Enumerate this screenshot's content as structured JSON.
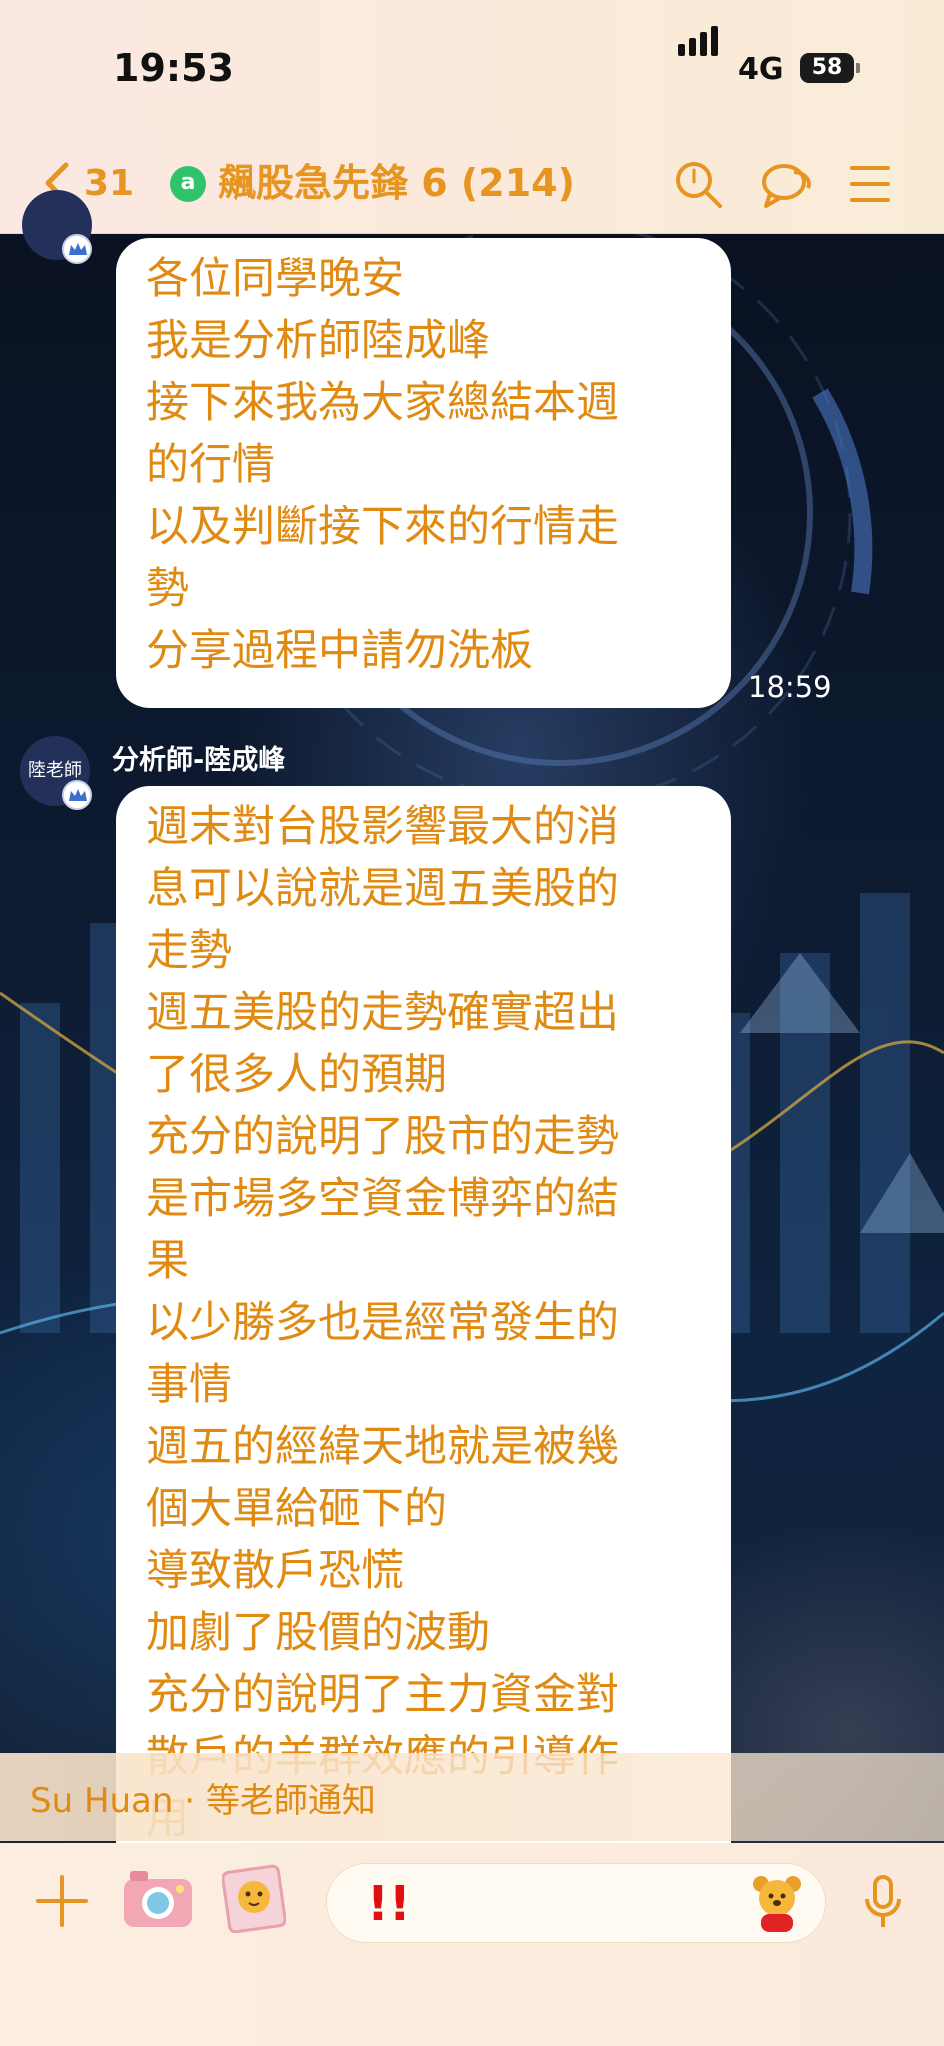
{
  "status_bar": {
    "time": "19:53",
    "network": "4G",
    "battery": "58"
  },
  "header": {
    "back_count": "31",
    "title": "飆股急先鋒 6 (214)",
    "icons": [
      "back-chevron-icon",
      "search-icon",
      "chat-bubbles-icon",
      "menu-icon"
    ],
    "accent_color": "#e59520"
  },
  "messages": [
    {
      "lines": [
        "各位同學晚安",
        "我是分析師陸成峰",
        "接下來我為大家總結本週",
        "的行情",
        "以及判斷接下來的行情走",
        "勢",
        "分享過程中請勿洗板"
      ],
      "time": "18:59"
    },
    {
      "sender": "分析師-陸成峰",
      "avatar_text": "陸老師",
      "lines": [
        "週末對台股影響最大的消",
        "息可以說就是週五美股的",
        "走勢",
        "週五美股的走勢確實超出",
        "了很多人的預期",
        "充分的說明了股市的走勢",
        "是市場多空資金博弈的結",
        "果",
        "以少勝多也是經常發生的",
        "事情",
        "週五的經緯天地就是被幾",
        "個大單給砸下的",
        "導致散戶恐慌",
        "加劇了股價的波動",
        "充分的說明了主力資金對",
        "散戶的羊群效應的引導作",
        "用"
      ]
    }
  ],
  "notice": "Su Huan · 等老師通知",
  "input": {
    "value": "!!"
  }
}
